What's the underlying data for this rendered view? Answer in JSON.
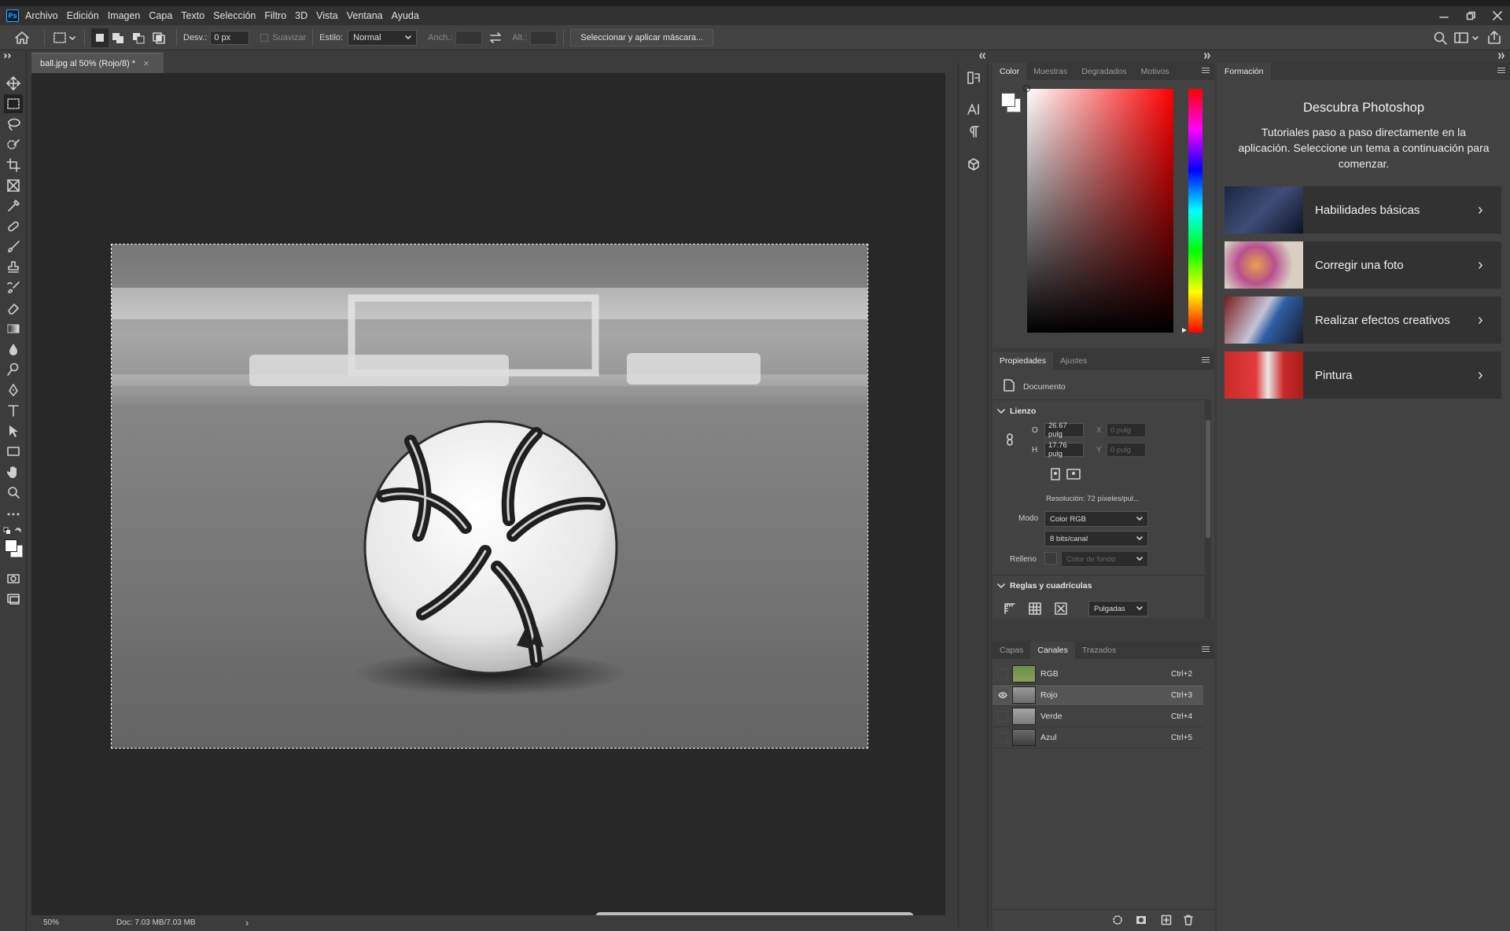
{
  "app": {
    "name": "Ps"
  },
  "menu": [
    "Archivo",
    "Edición",
    "Imagen",
    "Capa",
    "Texto",
    "Selección",
    "Filtro",
    "3D",
    "Vista",
    "Ventana",
    "Ayuda"
  ],
  "options": {
    "desv_label": "Desv.:",
    "desv_value": "0 px",
    "suavizar": "Suavizar",
    "estilo_label": "Estilo:",
    "estilo_value": "Normal",
    "anch_label": "Anch.:",
    "alt_label": "Alt.:",
    "mask_button": "Seleccionar y aplicar máscara..."
  },
  "document": {
    "tab_title": "ball.jpg al 50% (Rojo/8) *",
    "close": "×"
  },
  "status": {
    "zoom": "50%",
    "doc": "Doc: 7.03 MB/7.03 MB",
    "arrow": "›"
  },
  "color_panel": {
    "tabs": [
      "Color",
      "Muestras",
      "Degradados",
      "Motivos"
    ],
    "active": "Color"
  },
  "learn_panel": {
    "tab": "Formación",
    "title": "Descubra Photoshop",
    "description": "Tutoriales paso a paso directamente en la aplicación. Seleccione un tema a continuación para comenzar.",
    "cards": [
      "Habilidades básicas",
      "Corregir una foto",
      "Realizar efectos creativos",
      "Pintura"
    ],
    "chevron": "›"
  },
  "properties": {
    "tabs": [
      "Propiedades",
      "Ajustes"
    ],
    "type": "Documento",
    "canvas_section": "Lienzo",
    "w_label": "O",
    "w_value": "26.67 pulg",
    "h_label": "H",
    "h_value": "17.76 pulg",
    "x_label": "X",
    "x_placeholder": "0 pulg",
    "y_label": "Y",
    "y_placeholder": "0 pulg",
    "resolution": "Resolución: 72 píxeles/pul...",
    "mode_label": "Modo",
    "mode_value": "Color RGB",
    "bits_value": "8 bits/canal",
    "fill_label": "Relleno",
    "fill_value": "Color de fondo",
    "rulers_section": "Reglas y cuadrículas",
    "units_value": "Pulgadas"
  },
  "channels": {
    "tabs": [
      "Capas",
      "Canales",
      "Trazados"
    ],
    "active": "Canales",
    "rows": [
      {
        "name": "RGB",
        "shortcut": "Ctrl+2"
      },
      {
        "name": "Rojo",
        "shortcut": "Ctrl+3"
      },
      {
        "name": "Verde",
        "shortcut": "Ctrl+4"
      },
      {
        "name": "Azul",
        "shortcut": "Ctrl+5"
      }
    ]
  },
  "colors": {
    "accent": "#31a8ff",
    "panel": "#424242",
    "canvas_bg": "#282828"
  }
}
